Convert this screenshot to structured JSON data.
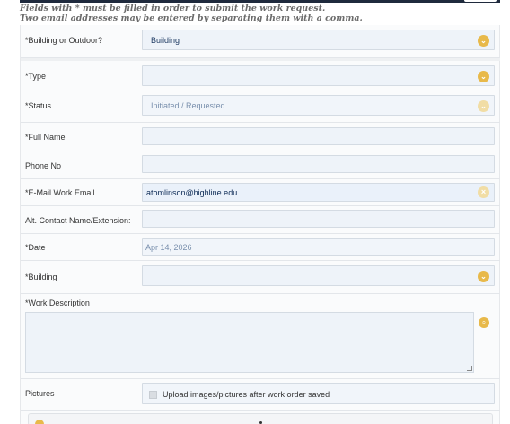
{
  "instructions": {
    "line1": "Fields with * must be filled in order to submit the work request.",
    "line2": "Two email addresses may be entered by separating them with a comma."
  },
  "form": {
    "building_or_outdoor": {
      "label": "*Building or Outdoor?",
      "value": "Building"
    },
    "type": {
      "label": "*Type",
      "value": ""
    },
    "status": {
      "label": "*Status",
      "value": "Initiated / Requested"
    },
    "full_name": {
      "label": "*Full Name",
      "value": ""
    },
    "phone_no": {
      "label": "Phone No",
      "value": ""
    },
    "email": {
      "label": "*E-Mail Work Email",
      "value": "atomlinson@highline.edu"
    },
    "alt_contact": {
      "label": "Alt. Contact Name/Extension:",
      "value": ""
    },
    "date": {
      "label": "*Date",
      "value": "Apr 14, 2026"
    },
    "building": {
      "label": "*Building",
      "value": ""
    },
    "work_description": {
      "label": "*Work Description",
      "value": ""
    },
    "pictures": {
      "label": "Pictures",
      "upload_label": "Upload images/pictures after work order saved"
    }
  },
  "colors": {
    "accent": "#e8b94a",
    "field_bg": "#eef3f9",
    "topbar": "#1f2a3d"
  },
  "icons": [
    "chevron-down-icon",
    "clear-icon",
    "search-icon",
    "checkbox"
  ]
}
